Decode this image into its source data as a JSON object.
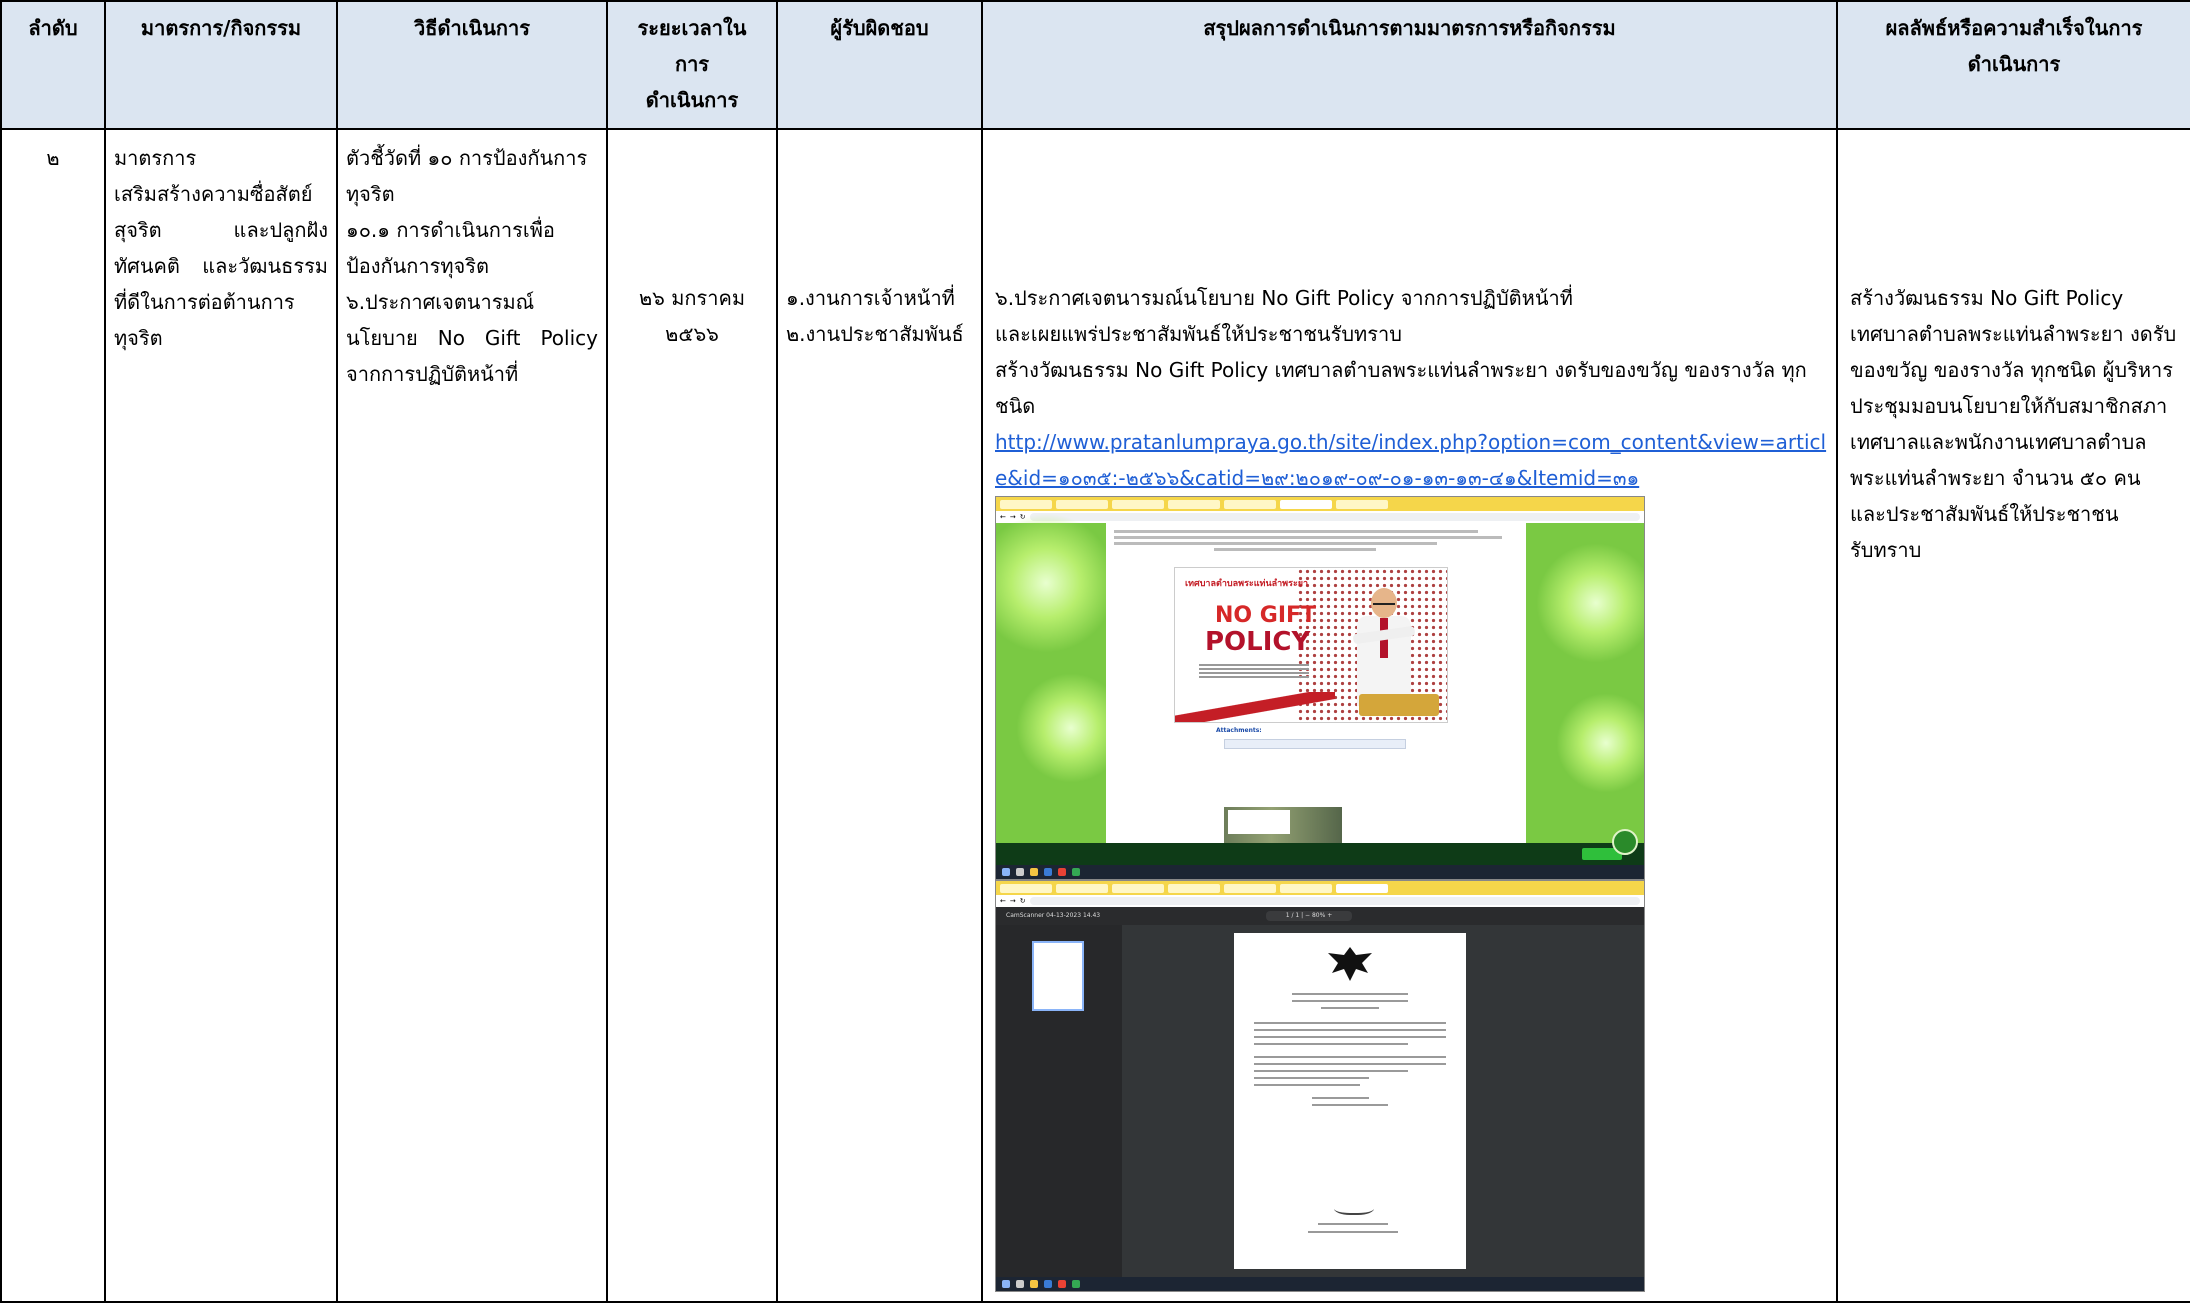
{
  "headers": [
    "ลำดับ",
    "มาตรการ/กิจกรรม",
    "วิธีดำเนินการ",
    "ระยะเวลาใน\nการ\nดำเนินการ",
    "ผู้รับผิดชอบ",
    "สรุปผลการดำเนินการตามมาตรการหรือกิจกรรม",
    "ผลลัพธ์หรือความสำเร็จในการ\nดำเนินการ"
  ],
  "row": {
    "number": "๒",
    "measure_lines": [
      "มาตรการ",
      "เสริมสร้างความซื่อสัตย์",
      "สุจริต และปลูกฝัง",
      "ทัศนคติ และวัฒนธรรม",
      "ที่ดีในการต่อต้านการ",
      "ทุจริต"
    ],
    "method_lines": [
      "ตัวชี้วัดที่ ๑๐ การป้องกันการ",
      "ทุจริต",
      "๑๐.๑ การดำเนินการเพื่อ",
      "ป้องกันการทุจริต",
      "๖.ประกาศเจตนารมณ์",
      "นโยบาย No Gift Policy",
      "จากการปฏิบัติหน้าที่"
    ],
    "duration_lines": [
      "๒๖ มกราคม",
      "๒๕๖๖"
    ],
    "responsible_lines": [
      "๑.งานการเจ้าหน้าที่",
      "๒.งานประชาสัมพันธ์"
    ],
    "summary_lines": [
      "๖.ประกาศเจตนารมณ์นโยบาย No Gift Policy จากการปฏิบัติหน้าที่",
      "และเผยแพร่ประชาสัมพันธ์ให้ประชาชนรับทราบ",
      "สร้างวัฒนธรรม No Gift Policy เทศบาลตำบลพระแท่นลำพระยา งดรับของขวัญ ของรางวัล ทุก",
      "ชนิด"
    ],
    "summary_link": "http://www.pratanlumpraya.go.th/site/index.php?option=com_content&view=article&id=๑๐๓๕:-๒๕๖๖&catid=๒๙:๒๐๑๙-๐๙-๐๑-๑๓-๑๓-๔๑&Itemid=๓๑",
    "result_lines": [
      "สร้างวัฒนธรรม No Gift Policy",
      "เทศบาลตำบลพระแท่นลำพระยา งดรับ",
      "ของขวัญ ของรางวัล ทุกชนิด ผู้บริหาร",
      "ประชุมมอบนโยบายให้กับสมาชิกสภา",
      "เทศบาลและพนักงานเทศบาลตำบล",
      "พระแท่นลำพระยา จำนวน  ๕๐ คน",
      "และประชาสัมพันธ์ให้ประชาชน",
      "รับทราบ"
    ]
  },
  "screenshot1": {
    "poster_title": "เทศบาลตำบลพระแท่นลำพระยา",
    "poster_no": "NO GIFT",
    "poster_policy": "POLICY",
    "attachments_label": "Attachments:"
  },
  "screenshot2": {
    "pdf_title": "CamScanner 04-13-2023 14.43",
    "zoom": "1 / 1  |  −  80%  +"
  },
  "colors": {
    "header_bg": "#dbe5f1",
    "link": "#1f5fd6",
    "browser_bar": "#f5d64a",
    "green_bg": "#7ac943"
  }
}
